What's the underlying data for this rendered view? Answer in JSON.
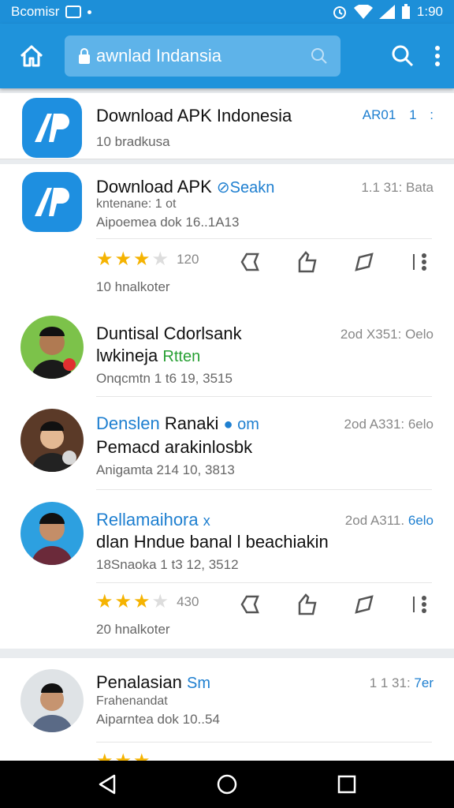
{
  "status_bar": {
    "carrier": "Bcomisr",
    "time": "1:90"
  },
  "app_bar": {
    "search_text": "awnlad Indansia"
  },
  "header_card": {
    "title": "Download APK Indonesia",
    "subtitle": "10 bradkusa",
    "meta": "AR01",
    "meta_count": "1"
  },
  "rows": [
    {
      "title": "Download APK",
      "title_tag": "Seakn",
      "line2": "kntenane: 1 ot",
      "line3": "Aipoemea dok 16..1A13",
      "meta": "1.1 31: Bata"
    },
    {
      "title": "Duntisal Cdorlsank",
      "line2a": "lwkineja",
      "line2b": "Rtten",
      "line3": "Onqcmtn 1 t6 19, 3515",
      "meta": "2od X351: Oelo"
    },
    {
      "title_blue": "Denslen",
      "title": "Ranaki",
      "title_tag": "om",
      "line2": "Pemacd arakinlosbk",
      "line3": "Anigamta 214 10, 3813",
      "meta": "2od A331: 6elo"
    },
    {
      "title_blue": "Rellamaihora",
      "title_tag": "x",
      "line2": "dlan Hndue banal l beachiakin",
      "line3": "18Snaoka 1 t3 12, 3512",
      "meta": "2od A311.",
      "meta_blue": "6elo"
    }
  ],
  "ratings": [
    {
      "count": "120",
      "sub": "10 hnalkoter"
    },
    {
      "count": "430",
      "sub": "20 hnalkoter"
    }
  ],
  "card3": {
    "title": "Penalasian",
    "title_tag": "Sm",
    "line2": "Frahenandat",
    "line3": "Aiparntea dok 10..54",
    "meta": "1 1 31:",
    "meta_blue": "7er"
  },
  "colors": {
    "primary": "#1f93db",
    "star": "#f5b301",
    "accent_blue": "#1e7fd0",
    "accent_green": "#27a033"
  }
}
